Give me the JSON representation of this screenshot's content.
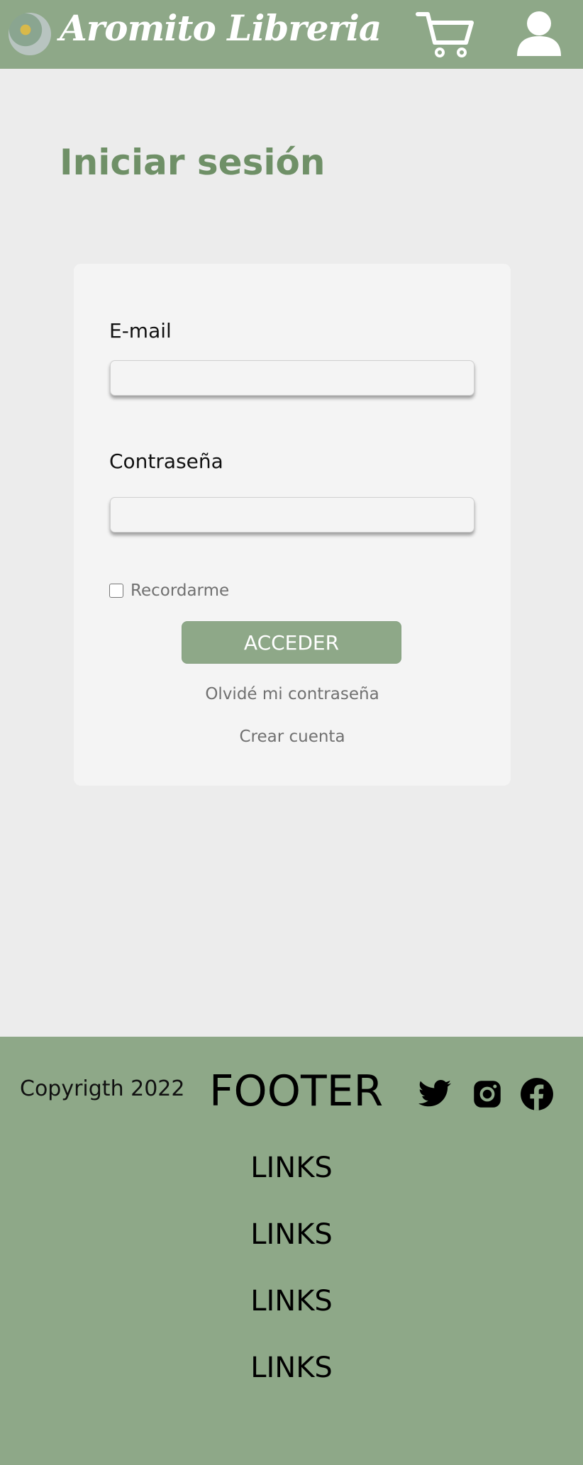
{
  "header": {
    "brand": "Aromito Libreria",
    "logo_icon": "bookstore-logo",
    "cart_icon": "cart-icon",
    "user_icon": "user-icon",
    "bg_color": "#8ea888"
  },
  "main": {
    "title": "Iniciar sesión",
    "title_color": "#6f9067",
    "form": {
      "email_label": "E-mail",
      "email_value": "",
      "password_label": "Contraseña",
      "password_value": "",
      "remember_label": "Recordarme",
      "remember_checked": false,
      "submit_label": "ACCEDER",
      "forgot_label": "Olvidé mi contraseña",
      "create_label": "Crear cuenta"
    }
  },
  "footer": {
    "copyright": "Copyrigth 2022",
    "title": "FOOTER",
    "social_icons": [
      "twitter-icon",
      "instagram-icon",
      "facebook-icon"
    ],
    "links": [
      "LINKS",
      "LINKS",
      "LINKS",
      "LINKS"
    ]
  }
}
